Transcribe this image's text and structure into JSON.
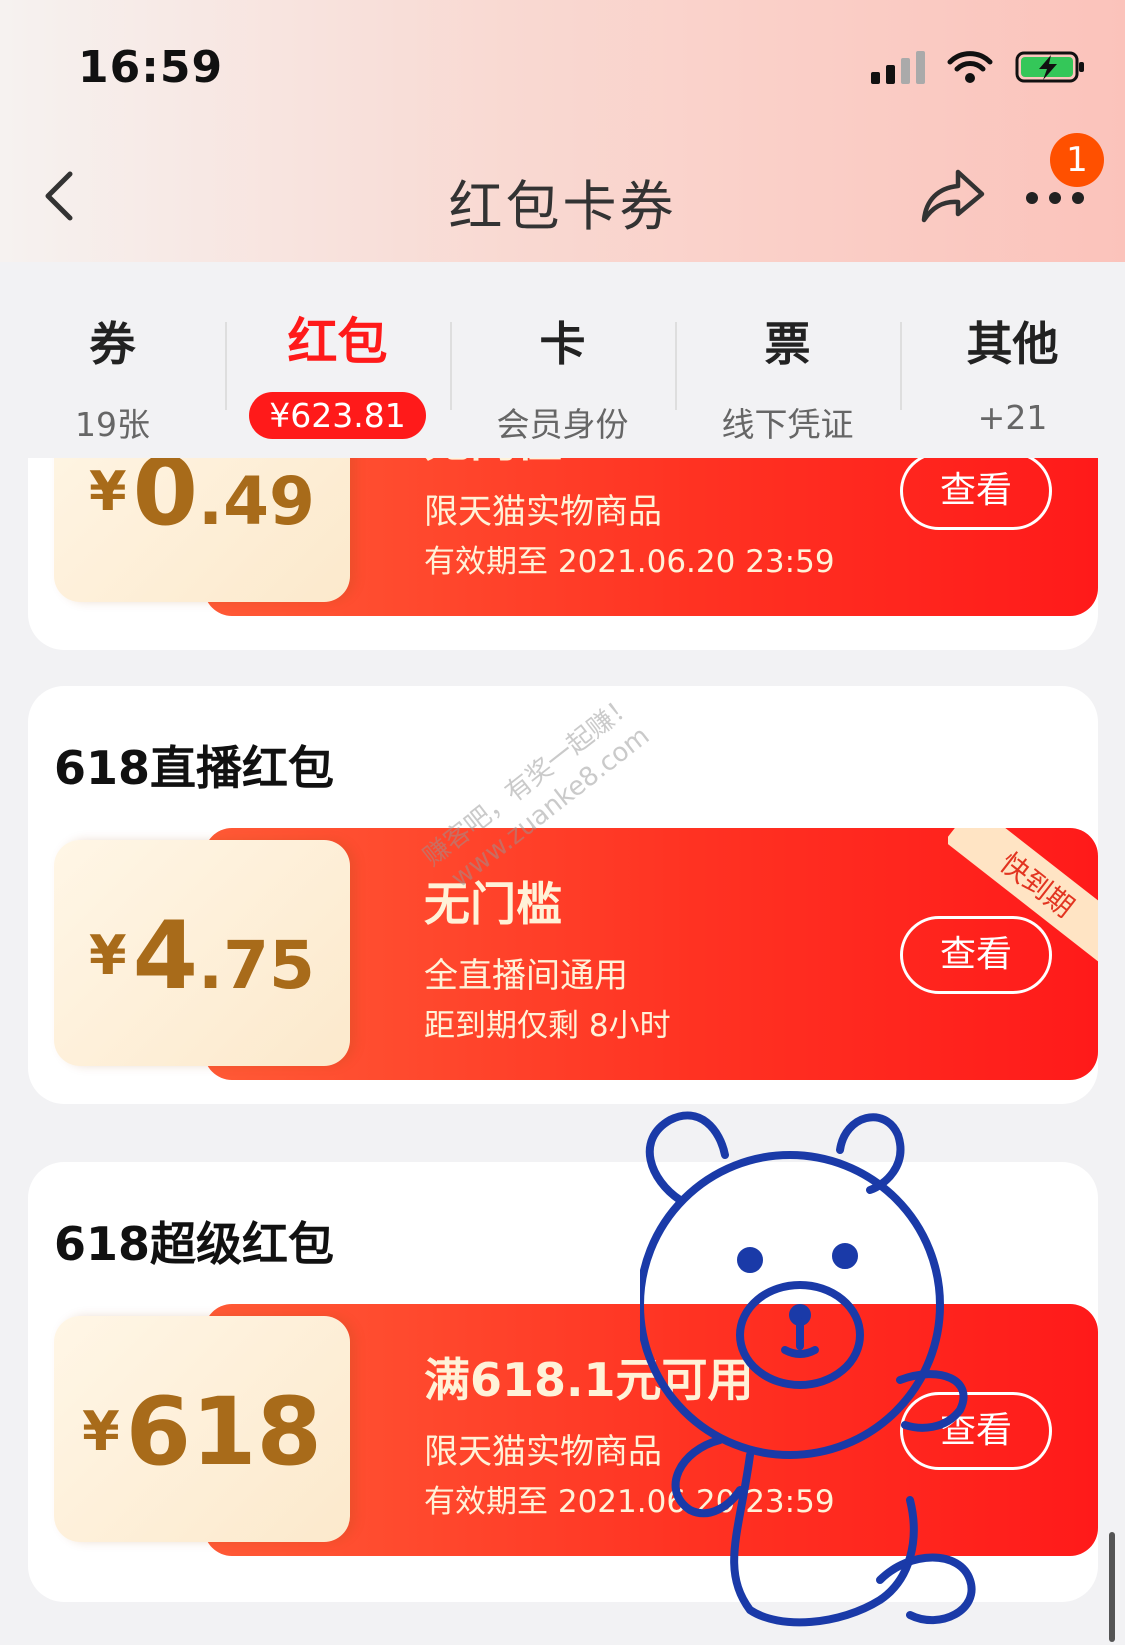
{
  "status_bar": {
    "time": "16:59"
  },
  "nav": {
    "title": "红包卡券",
    "badge_count": "1"
  },
  "tabs": [
    {
      "title": "券",
      "sub": "19张"
    },
    {
      "title": "红包",
      "sub": "¥623.81"
    },
    {
      "title": "卡",
      "sub": "会员身份"
    },
    {
      "title": "票",
      "sub": "线下凭证"
    },
    {
      "title": "其他",
      "sub": "+21"
    }
  ],
  "coupons": [
    {
      "currency": "¥",
      "amount_int": "0",
      "amount_dec": ".49",
      "condition": "无门槛",
      "desc": "限天猫实物商品",
      "expiry": "有效期至 2021.06.20 23:59",
      "button": "查看"
    },
    {
      "section_title": "618直播红包",
      "currency": "¥",
      "amount_int": "4",
      "amount_dec": ".75",
      "condition": "无门槛",
      "desc": "全直播间通用",
      "expiry": "距到期仅剩 8小时",
      "button": "查看",
      "ribbon": "快到期"
    },
    {
      "section_title": "618超级红包",
      "currency": "¥",
      "amount_int": "618",
      "amount_dec": "",
      "condition": "满618.1元可用",
      "desc": "限天猫实物商品",
      "expiry": "有效期至 2021.06.20 23:59",
      "button": "查看"
    }
  ],
  "watermark": {
    "line1": "赚客吧，有奖一起赚！",
    "line2": "www.zuanke8.com"
  },
  "colors": {
    "accent": "#ff1a1a",
    "coupon_gold": "#a86b1a",
    "badge": "#ff5000"
  }
}
